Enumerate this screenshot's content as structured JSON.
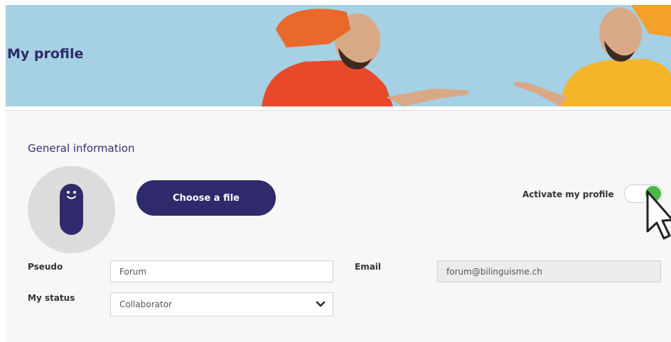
{
  "header": {
    "title": "My profile"
  },
  "section": {
    "title": "General information"
  },
  "avatar": {
    "icon": "smiley-pill-icon"
  },
  "upload": {
    "button_label": "Choose a file"
  },
  "profile_toggle": {
    "label": "Activate my profile",
    "state": "on"
  },
  "form": {
    "pseudo": {
      "label": "Pseudo",
      "value": "Forum"
    },
    "email": {
      "label": "Email",
      "value": "forum@bilinguisme.ch"
    },
    "status": {
      "label": "My status",
      "value": "Collaborator"
    }
  },
  "colors": {
    "brand": "#2f2a6b",
    "toggle_on": "#4cb84c",
    "banner_bg": "#a6d0e3"
  }
}
